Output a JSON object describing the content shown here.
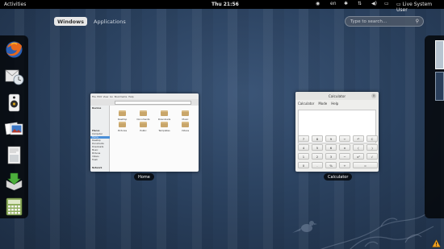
{
  "topbar": {
    "activities_label": "Activities",
    "clock": "Thu 21:56",
    "keyboard_layout": "en",
    "user_label": "Live System User"
  },
  "overview": {
    "tabs": [
      {
        "label": "Windows",
        "active": true
      },
      {
        "label": "Applications",
        "active": false
      }
    ],
    "search_placeholder": "Type to search..."
  },
  "dash": {
    "items": [
      "firefox-icon",
      "evolution-icon",
      "rhythmbox-icon",
      "shotwell-icon",
      "document-viewer-icon",
      "software-installer-icon",
      "calculator-icon"
    ]
  },
  "windows": [
    {
      "label": "Home",
      "menu": [
        "File",
        "Edit",
        "View",
        "Go",
        "Bookmarks",
        "Help"
      ],
      "sidebar": [
        "Devices",
        "Places",
        "Computer",
        "Home",
        "Desktop",
        "Documents",
        "Downloads",
        "Music",
        "Pictures",
        "Videos",
        "Trash",
        "Network"
      ],
      "folders": [
        "Desktop",
        "Documents",
        "Downloads",
        "Music",
        "Pictures",
        "Public",
        "Templates",
        "Videos"
      ]
    },
    {
      "label": "Calculator",
      "title": "Calculator",
      "menu": [
        "Calculator",
        "Mode",
        "Help"
      ],
      "keys": [
        [
          "7",
          "8",
          "9",
          "÷",
          "↶",
          "C"
        ],
        [
          "4",
          "5",
          "6",
          "×",
          "(",
          ")"
        ],
        [
          "1",
          "2",
          "3",
          "−",
          "x²",
          "√"
        ],
        [
          "0",
          ".",
          "%",
          "+",
          "="
        ]
      ]
    }
  ],
  "colors": {
    "topbar": "#000000",
    "selection": "#4a8fd8",
    "wallpaper": "#2b4260"
  }
}
